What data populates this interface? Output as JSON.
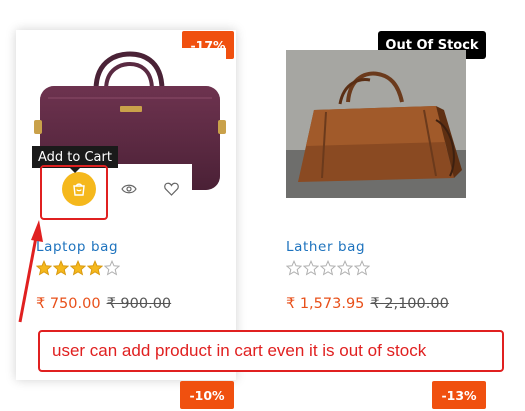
{
  "products": [
    {
      "name": "Laptop bag",
      "discount": "-17%",
      "price_current": "₹ 750.00",
      "price_old": "₹ 900.00",
      "rating": 4,
      "image": "purple laptop bag"
    },
    {
      "name": "Lather bag",
      "badge": "Out Of Stock",
      "price_current": "₹ 1,573.95",
      "price_old": "₹ 2,100.00",
      "rating": 0,
      "image": "brown leather handbag"
    }
  ],
  "next_row_discounts": [
    "-10%",
    "-13%"
  ],
  "tooltip": "Add to Cart",
  "annotation": "user can add product in cart even it is out of stock",
  "colors": {
    "discount_badge": "#f0500f",
    "price": "#e8501a",
    "product_link": "#1e73be",
    "cart_button": "#f5b81c",
    "annotation_red": "#e02020",
    "star_filled": "#f5b81c"
  },
  "icons": {
    "cart": "shopping-bag-icon",
    "quick_view": "eye-icon",
    "wishlist": "heart-icon",
    "rating": "star-icon"
  }
}
